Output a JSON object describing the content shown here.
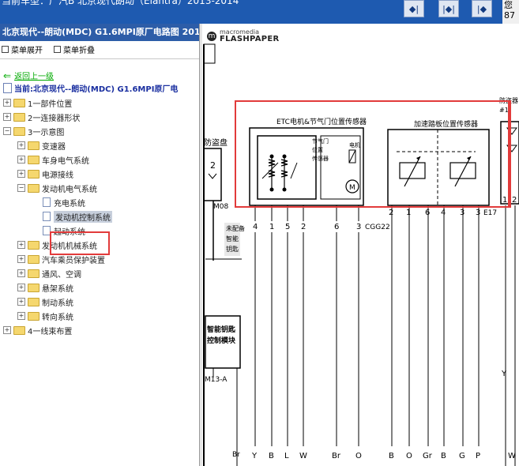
{
  "window": {
    "title": "当前车型：广汽B 北京现代朗动（Elantra）2013-2014",
    "corner_text": [
      "您",
      "87"
    ]
  },
  "nav": {
    "first": "◆|",
    "middle": "|◆|",
    "last": "|◆"
  },
  "sidebar": {
    "header": "北京现代--朗动(MDC) G1.6MPI原厂电路图 2013",
    "expand_menu": "菜单展开",
    "collapse_menu": "菜单折叠",
    "back": "返回上一级",
    "current": "当前:北京现代--朗动(MDC) G1.6MPI原厂电",
    "tree": [
      {
        "label": "1一部件位置"
      },
      {
        "label": "2一连接器形状"
      },
      {
        "label": "3一示意图"
      },
      {
        "label": "变速器"
      },
      {
        "label": "车身电气系统"
      },
      {
        "label": "电源接线"
      },
      {
        "label": "发动机电气系统"
      },
      {
        "label": "充电系统"
      },
      {
        "label": "发动机控制系统"
      },
      {
        "label": "起动系统"
      },
      {
        "label": "发动机机械系统"
      },
      {
        "label": "汽车乘员保护装置"
      },
      {
        "label": "通风、空调"
      },
      {
        "label": "悬架系统"
      },
      {
        "label": "制动系统"
      },
      {
        "label": "转向系统"
      },
      {
        "label": "4一线束布置"
      }
    ]
  },
  "viewer": {
    "logo_top": "macromedia",
    "logo_bottom": "FLASHPAPER",
    "diagram": {
      "etc_title": "ETC电机&节气门位置传感器",
      "tps_label": [
        "节气门",
        "位置",
        "传感器"
      ],
      "motor_label": "电机",
      "motor_symbol": "M",
      "apps_title": "加速踏板位置传感器",
      "left_block_top": "防盗盘",
      "left_block_num": "2",
      "m08": "M08",
      "unassigned": [
        "未配备",
        "智能",
        "钥匙"
      ],
      "smart_key": [
        "智能钥匙",
        "控制模块"
      ],
      "m13a": "M13-A",
      "etc_pins": [
        "4",
        "1",
        "5",
        "2",
        "6",
        "3"
      ],
      "etc_conn": "CGG22",
      "apps_pins": [
        "2",
        "1",
        "6",
        "4",
        "3",
        "3"
      ],
      "apps_conn": "E17",
      "right_pins": [
        "1",
        "2"
      ],
      "right_top": [
        "防盗器",
        "#1"
      ],
      "wire_colors": [
        "Br",
        "Y",
        "B",
        "L",
        "W",
        "Br",
        "O",
        "B",
        "O",
        "Gr",
        "B",
        "G",
        "P",
        "W"
      ],
      "y_label": "Y"
    }
  }
}
